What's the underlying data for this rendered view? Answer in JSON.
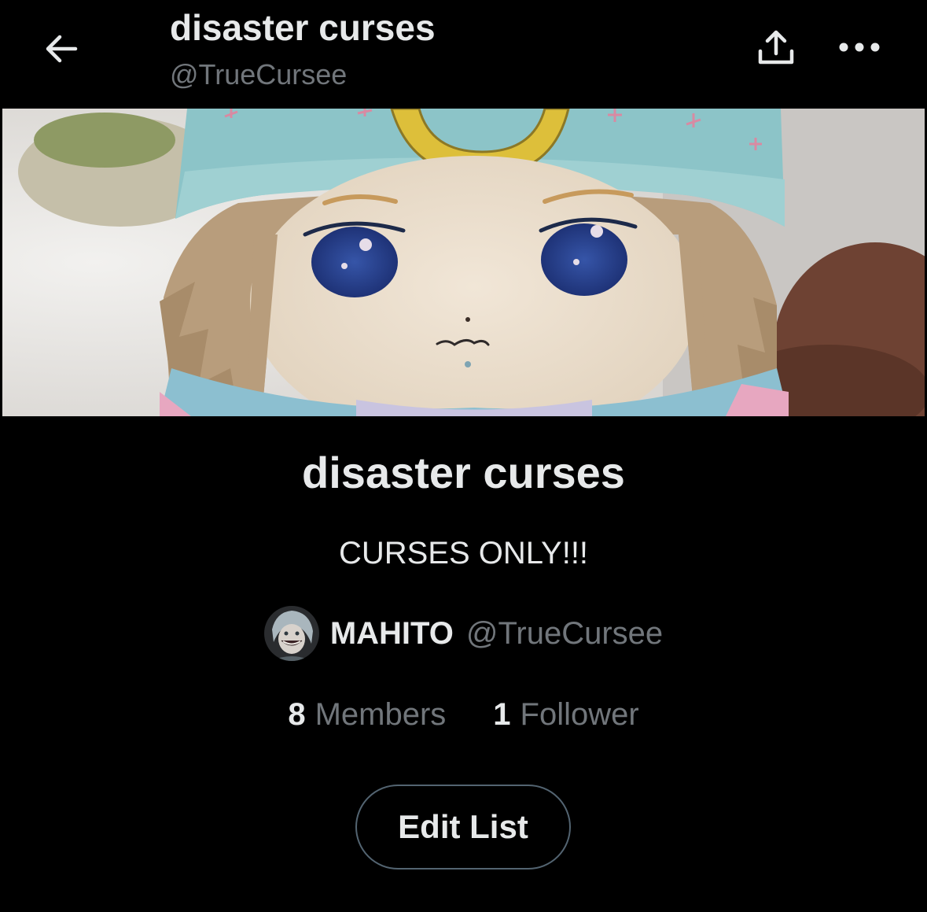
{
  "header": {
    "title": "disaster curses",
    "handle": "@TrueCursee",
    "icons": {
      "back": "back-arrow-icon",
      "share": "share-icon",
      "more": "more-icon"
    }
  },
  "banner": {
    "alt": "Banner photo of a felt plush doll with blond hair, blue eyes and a light-blue hat with a yellow crescent moon"
  },
  "list": {
    "name": "disaster curses",
    "description": "CURSES ONLY!!!",
    "owner": {
      "name": "MAHITO",
      "handle": "@TrueCursee"
    },
    "stats": {
      "members_count": "8",
      "members_label": "Members",
      "followers_count": "1",
      "followers_label": "Follower"
    },
    "edit_button": "Edit List"
  },
  "colors": {
    "background": "#000000",
    "primary_text": "#e7e9ea",
    "secondary_text": "#71767b",
    "button_border": "#536471"
  }
}
